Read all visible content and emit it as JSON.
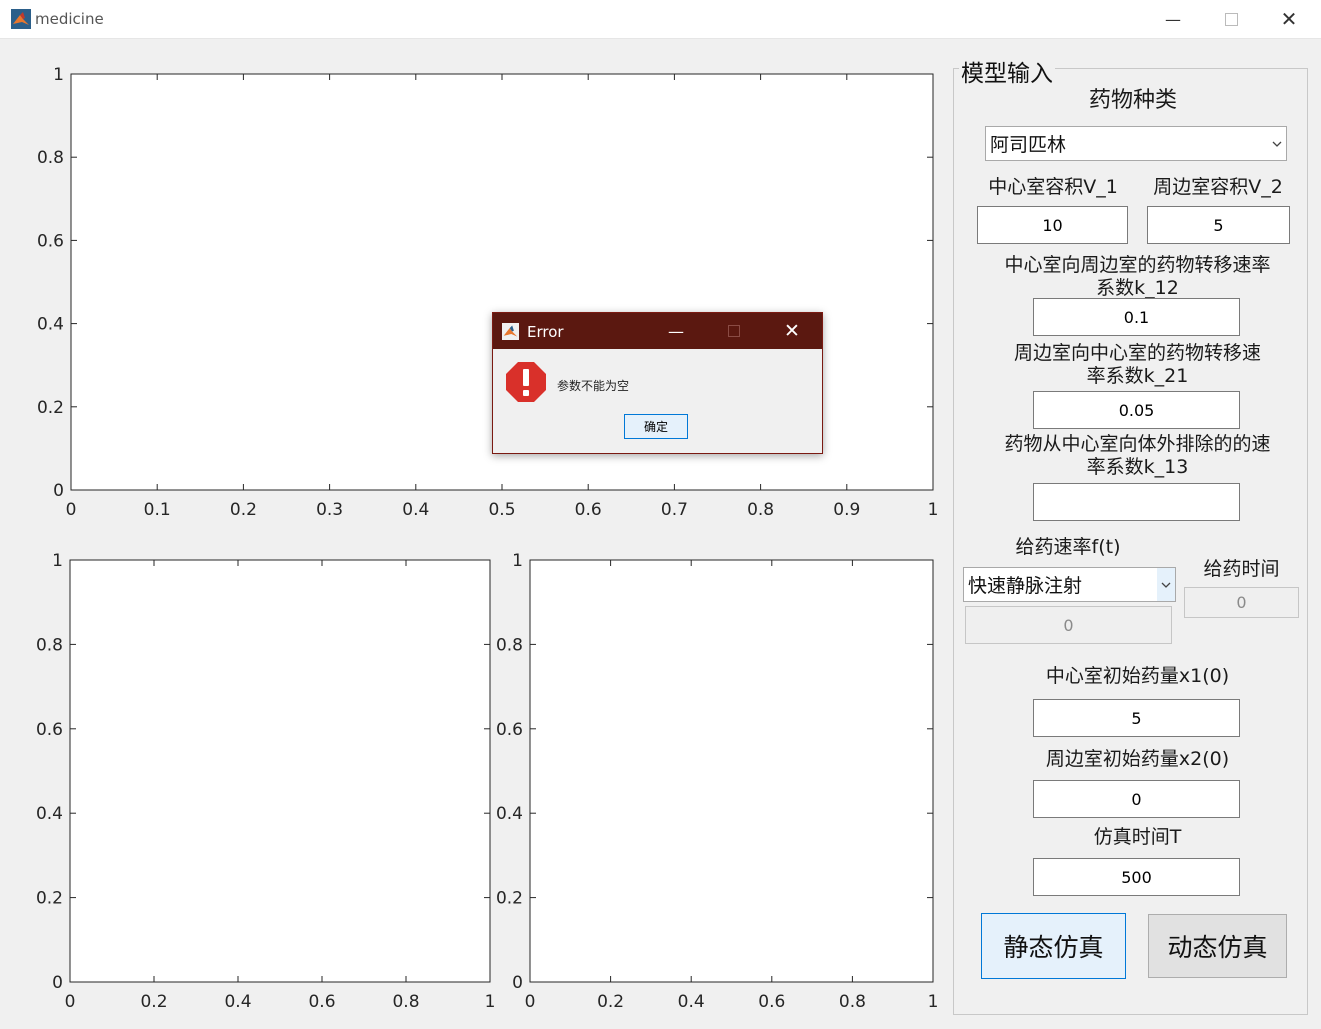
{
  "window": {
    "title": "medicine"
  },
  "axes": {
    "top": {
      "xticks": [
        "0",
        "0.1",
        "0.2",
        "0.3",
        "0.4",
        "0.5",
        "0.6",
        "0.7",
        "0.8",
        "0.9",
        "1"
      ],
      "yticks": [
        "0",
        "0.2",
        "0.4",
        "0.6",
        "0.8",
        "1"
      ]
    },
    "bottom_left": {
      "xticks": [
        "0",
        "0.2",
        "0.4",
        "0.6",
        "0.8",
        "1"
      ],
      "yticks": [
        "0",
        "0.2",
        "0.4",
        "0.6",
        "0.8",
        "1"
      ]
    },
    "bottom_right": {
      "xticks": [
        "0",
        "0.2",
        "0.4",
        "0.6",
        "0.8",
        "1"
      ],
      "yticks": [
        "0",
        "0.2",
        "0.4",
        "0.6",
        "0.8",
        "1"
      ]
    }
  },
  "panel": {
    "title": "模型输入",
    "drug_type_label": "药物种类",
    "drug_type_value": "阿司匹林",
    "v1_label": "中心室容积V_1",
    "v1_value": "10",
    "v2_label": "周边室容积V_2",
    "v2_value": "5",
    "k12_label_line1": "中心室向周边室的药物转移速率",
    "k12_label_line2": "系数k_12",
    "k12_value": "0.1",
    "k21_label_line1": "周边室向中心室的药物转移速",
    "k21_label_line2": "率系数k_21",
    "k21_value": "0.05",
    "k13_label_line1": "药物从中心室向体外排除的的速",
    "k13_label_line2": "率系数k_13",
    "k13_value": "",
    "rate_label": "给药速率f(t)",
    "rate_select_value": "快速静脉注射",
    "rate_value": "0",
    "time_label": "给药时间",
    "time_value": "0",
    "x1_label": "中心室初始药量x1(0)",
    "x1_value": "5",
    "x2_label": "周边室初始药量x2(0)",
    "x2_value": "0",
    "T_label": "仿真时间T",
    "T_value": "500",
    "static_button": "静态仿真",
    "dynamic_button": "动态仿真"
  },
  "dialog": {
    "title": "Error",
    "message": "参数不能为空",
    "ok_button": "确定"
  },
  "colors": {
    "dialog_bar": "#5b1810",
    "error_icon": "#d9302a",
    "accent": "#0078d7"
  }
}
